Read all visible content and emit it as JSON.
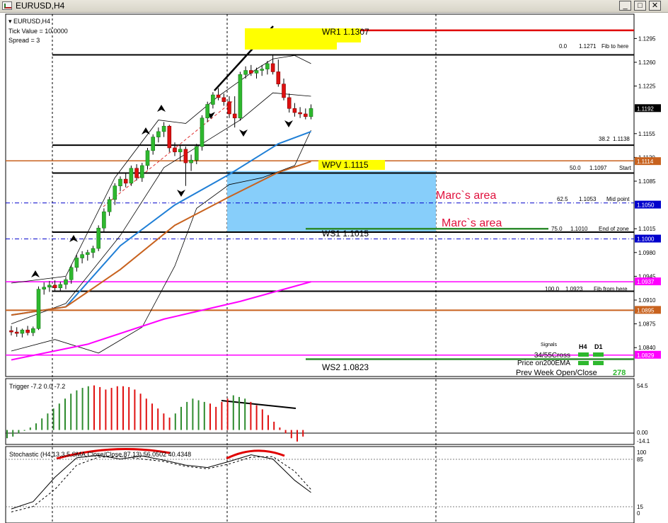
{
  "window": {
    "title": "EURUSD,H4",
    "buttons": [
      "_",
      "□",
      "✕"
    ]
  },
  "chart_data": {
    "type": "candlestick",
    "symbol": "EURUSD",
    "timeframe": "H4",
    "info_lines": [
      "▾ EURUSD,H4",
      "Tick Value = 10.0000",
      "Spread = 3"
    ],
    "ylim": [
      1.081,
      1.131
    ],
    "price_ticks": [
      "1.1295",
      "1.1260",
      "1.1225",
      "1.1155",
      "1.1120",
      "1.1085",
      "1.1015",
      "1.0980",
      "1.0945",
      "1.0910",
      "1.0875",
      "1.0840"
    ],
    "price_badges": [
      {
        "label": "1.1192",
        "value": 1.1192,
        "color": "#000000"
      },
      {
        "label": "1.1114",
        "value": 1.1114,
        "color": "#c8621e"
      },
      {
        "label": "1.1050",
        "value": 1.105,
        "color": "#0000cc"
      },
      {
        "label": "1.1000",
        "value": 1.1,
        "color": "#0000cc"
      },
      {
        "label": "1.0937",
        "value": 1.0937,
        "color": "#ff00ff"
      },
      {
        "label": "1.0895",
        "value": 1.0895,
        "color": "#c8621e"
      },
      {
        "label": "1.0829",
        "value": 1.0829,
        "color": "#ff00ff"
      }
    ],
    "candles": [
      [
        1.0865,
        1.0872,
        1.0858,
        1.0863
      ],
      [
        1.0863,
        1.087,
        1.0856,
        1.0861
      ],
      [
        1.0861,
        1.0868,
        1.0855,
        1.0866
      ],
      [
        1.0866,
        1.0872,
        1.0858,
        1.0862
      ],
      [
        1.0862,
        1.0871,
        1.0857,
        1.0868
      ],
      [
        1.0868,
        1.093,
        1.0866,
        1.0926
      ],
      [
        1.0926,
        1.0936,
        1.0918,
        1.0929
      ],
      [
        1.0929,
        1.0938,
        1.0922,
        1.0932
      ],
      [
        1.0932,
        1.0939,
        1.0924,
        1.0928
      ],
      [
        1.0928,
        1.0937,
        1.0922,
        1.0933
      ],
      [
        1.0933,
        1.0944,
        1.0926,
        1.094
      ],
      [
        1.094,
        1.0962,
        1.0934,
        1.0958
      ],
      [
        1.0958,
        1.0976,
        1.0952,
        1.0972
      ],
      [
        1.0972,
        1.0982,
        1.0964,
        1.0977
      ],
      [
        1.0977,
        1.0984,
        1.0968,
        1.098
      ],
      [
        1.098,
        1.099,
        1.0972,
        1.0986
      ],
      [
        1.0986,
        1.102,
        1.0982,
        1.1016
      ],
      [
        1.1016,
        1.1045,
        1.101,
        1.104
      ],
      [
        1.104,
        1.1062,
        1.1034,
        1.1058
      ],
      [
        1.1058,
        1.1082,
        1.105,
        1.1078
      ],
      [
        1.1078,
        1.1092,
        1.107,
        1.1088
      ],
      [
        1.1088,
        1.1096,
        1.1076,
        1.1082
      ],
      [
        1.1082,
        1.1108,
        1.1078,
        1.1104
      ],
      [
        1.1104,
        1.111,
        1.1086,
        1.109
      ],
      [
        1.109,
        1.1112,
        1.1084,
        1.1108
      ],
      [
        1.1108,
        1.1134,
        1.1102,
        1.113
      ],
      [
        1.113,
        1.1154,
        1.1124,
        1.115
      ],
      [
        1.115,
        1.1164,
        1.1142,
        1.1158
      ],
      [
        1.1158,
        1.1172,
        1.115,
        1.1166
      ],
      [
        1.1166,
        1.1168,
        1.1128,
        1.1134
      ],
      [
        1.1134,
        1.1142,
        1.1122,
        1.1128
      ],
      [
        1.1128,
        1.1138,
        1.1114,
        1.1132
      ],
      [
        1.1132,
        1.1136,
        1.1078,
        1.1112
      ],
      [
        1.1112,
        1.1124,
        1.11,
        1.1116
      ],
      [
        1.1116,
        1.114,
        1.111,
        1.1136
      ],
      [
        1.1136,
        1.1182,
        1.113,
        1.1178
      ],
      [
        1.1178,
        1.1202,
        1.1172,
        1.1198
      ],
      [
        1.1198,
        1.1216,
        1.1192,
        1.1212
      ],
      [
        1.1212,
        1.1222,
        1.1204,
        1.1208
      ],
      [
        1.1208,
        1.1214,
        1.1196,
        1.1202
      ],
      [
        1.1202,
        1.121,
        1.1178,
        1.1184
      ],
      [
        1.1184,
        1.121,
        1.1164,
        1.1178
      ],
      [
        1.1178,
        1.1246,
        1.1174,
        1.1242
      ],
      [
        1.1242,
        1.1254,
        1.1236,
        1.1248
      ],
      [
        1.1248,
        1.1256,
        1.124,
        1.1244
      ],
      [
        1.1244,
        1.1252,
        1.1236,
        1.1248
      ],
      [
        1.1248,
        1.1256,
        1.124,
        1.125
      ],
      [
        1.125,
        1.1262,
        1.1242,
        1.1258
      ],
      [
        1.1258,
        1.127,
        1.1242,
        1.1246
      ],
      [
        1.1246,
        1.1264,
        1.1224,
        1.1228
      ],
      [
        1.1228,
        1.1236,
        1.1204,
        1.1208
      ],
      [
        1.1208,
        1.1214,
        1.1186,
        1.1192
      ],
      [
        1.1192,
        1.12,
        1.118,
        1.1186
      ],
      [
        1.1186,
        1.1194,
        1.1178,
        1.1184
      ],
      [
        1.1184,
        1.1192,
        1.1176,
        1.118
      ],
      [
        1.118,
        1.1198,
        1.1176,
        1.1192
      ]
    ],
    "moving_averages": [
      {
        "name": "ma-blue",
        "color": "#1f7fd6",
        "values": [
          [
            0,
            1.0888
          ],
          [
            10,
            1.09
          ],
          [
            20,
            1.099
          ],
          [
            30,
            1.105
          ],
          [
            40,
            1.1095
          ],
          [
            49,
            1.114
          ],
          [
            55,
            1.1158
          ]
        ]
      },
      {
        "name": "ma-orange",
        "color": "#c8621e",
        "values": [
          [
            0,
            1.0888
          ],
          [
            10,
            1.09
          ],
          [
            20,
            1.0955
          ],
          [
            30,
            1.102
          ],
          [
            40,
            1.1062
          ],
          [
            49,
            1.1098
          ],
          [
            55,
            1.1114
          ]
        ]
      },
      {
        "name": "ma-200ema-magenta",
        "color": "#ff00ff",
        "values": [
          [
            0,
            1.0822
          ],
          [
            14,
            1.0845
          ],
          [
            28,
            1.0882
          ],
          [
            42,
            1.0908
          ],
          [
            55,
            1.0937
          ]
        ]
      }
    ],
    "bollinger": {
      "upper": [
        [
          0,
          1.0935
        ],
        [
          10,
          1.0945
        ],
        [
          19,
          1.109
        ],
        [
          27,
          1.1175
        ],
        [
          32,
          1.117
        ],
        [
          38,
          1.121
        ],
        [
          45,
          1.125
        ],
        [
          48,
          1.1265
        ],
        [
          52,
          1.127
        ],
        [
          55,
          1.1258
        ]
      ],
      "middle": [
        [
          0,
          1.0875
        ],
        [
          10,
          1.0905
        ],
        [
          20,
          1.1005
        ],
        [
          28,
          1.1105
        ],
        [
          35,
          1.114
        ],
        [
          42,
          1.1175
        ],
        [
          48,
          1.1215
        ],
        [
          55,
          1.121
        ]
      ],
      "lower": [
        [
          0,
          1.0835
        ],
        [
          8,
          1.0852
        ],
        [
          16,
          1.0832
        ],
        [
          24,
          1.087
        ],
        [
          30,
          1.096
        ],
        [
          34,
          1.1045
        ],
        [
          40,
          1.108
        ],
        [
          46,
          1.109
        ],
        [
          52,
          1.1108
        ],
        [
          55,
          1.116
        ]
      ]
    },
    "zone": {
      "from_value": 1.101,
      "to_value": 1.11,
      "color": "#87cefa"
    },
    "levels": [
      {
        "name": "wr1",
        "label": "WR1  1.1307",
        "value": 1.1307,
        "color": "#e00000",
        "width": 2.5
      },
      {
        "name": "fib-0",
        "value": 1.1271,
        "color": "#000000",
        "width": 2
      },
      {
        "name": "fib-38",
        "value": 1.1138,
        "color": "#000000",
        "width": 2
      },
      {
        "name": "wpv",
        "label": "WPV  1.1115",
        "value": 1.1115,
        "color": "#c8621e",
        "width": 1.5
      },
      {
        "name": "fib-50",
        "value": 1.1097,
        "color": "#000000",
        "width": 2
      },
      {
        "name": "fib-62",
        "value": 1.1053,
        "color": "#0000cc",
        "width": 1,
        "dash": true
      },
      {
        "name": "ws1",
        "label": "WS1  1.1015",
        "value": 1.1015,
        "color": "#2e8b2e",
        "width": 2.5
      },
      {
        "name": "fib-75",
        "value": 1.101,
        "color": "#000000",
        "width": 2
      },
      {
        "name": "pivot-1000",
        "value": 1.1,
        "color": "#0000cc",
        "width": 1,
        "dash": true
      },
      {
        "name": "magenta-0937",
        "value": 1.0937,
        "color": "#ff00ff",
        "width": 1.5
      },
      {
        "name": "fib-100",
        "value": 1.0923,
        "color": "#000000",
        "width": 2
      },
      {
        "name": "orange-0895",
        "value": 1.0895,
        "color": "#c8621e",
        "width": 2
      },
      {
        "name": "magenta-0829",
        "value": 1.0829,
        "color": "#ff00ff",
        "width": 1.5
      },
      {
        "name": "ws2",
        "label": "WS2  1.0823",
        "value": 1.0823,
        "color": "#2e8b2e",
        "width": 2.5
      }
    ],
    "fib_labels": [
      {
        "name": "fib-0-label",
        "level": "0.0",
        "price": "1.1271",
        "tag": "Fib to here"
      },
      {
        "name": "fib-38-label",
        "level": "38.2",
        "price": "1.1138",
        "tag": ""
      },
      {
        "name": "fib-50-label",
        "level": "50.0",
        "price": "1.1097",
        "tag": "Start"
      },
      {
        "name": "fib-62-label",
        "level": "62.5",
        "price": "1.1053",
        "tag": "Mid point"
      },
      {
        "name": "fib-75-label",
        "level": "75.0",
        "price": "1.1010",
        "tag": "End of zone"
      },
      {
        "name": "fib-100-label",
        "level": "100.0",
        "price": "1.0923",
        "tag": "Fib from here"
      }
    ],
    "annotations": [
      {
        "name": "marcs-area-1",
        "text": "Marc`s area",
        "color": "#e0103c"
      },
      {
        "name": "marcs-area-2",
        "text": "Marc`s area",
        "color": "#e0103c"
      }
    ],
    "signals_panel": {
      "title": "Signals",
      "headers": [
        "H4",
        "D1"
      ],
      "rows": [
        "34/55Cross",
        "Price on200EMA"
      ],
      "footer_label": "Prev Week Open/Close",
      "footer_value": "278",
      "signal_color": "#2eb82e"
    },
    "trigger": {
      "label": "Trigger -7.2 0.0 -7.2",
      "scale": [
        "54.5",
        "0.00",
        "-14.1"
      ],
      "ylim": [
        -14.1,
        54.5
      ],
      "values": [
        -10,
        -8,
        -4,
        -1,
        3,
        8,
        14,
        20,
        26,
        32,
        38,
        44,
        48,
        51,
        53,
        54,
        52,
        49,
        51,
        53,
        53,
        52,
        49,
        44,
        38,
        32,
        26,
        20,
        15,
        20,
        28,
        34,
        38,
        36,
        34,
        32,
        28,
        34,
        38,
        42,
        40,
        38,
        34,
        30,
        25,
        18,
        10,
        3,
        -4,
        -10,
        -14,
        -8
      ],
      "colors": "gggggggggggggggrrrrrrrrrrrrrrggggggrrrrgggrrrrrrrrrr"
    },
    "stochastic": {
      "label": "Stochastic (H4,13,3,5,SMA,Close/Close,87.13) 56.0502 40.4348",
      "scale": [
        "100",
        "85",
        "15",
        "0"
      ],
      "k": [
        [
          0,
          8
        ],
        [
          4,
          20
        ],
        [
          8,
          60
        ],
        [
          12,
          92
        ],
        [
          16,
          96
        ],
        [
          20,
          90
        ],
        [
          24,
          95
        ],
        [
          28,
          88
        ],
        [
          32,
          80
        ],
        [
          36,
          76
        ],
        [
          40,
          86
        ],
        [
          44,
          97
        ],
        [
          48,
          90
        ],
        [
          52,
          55
        ],
        [
          55,
          35
        ]
      ],
      "d": [
        [
          0,
          3
        ],
        [
          4,
          12
        ],
        [
          8,
          40
        ],
        [
          12,
          80
        ],
        [
          16,
          93
        ],
        [
          20,
          94
        ],
        [
          24,
          90
        ],
        [
          28,
          86
        ],
        [
          32,
          78
        ],
        [
          36,
          74
        ],
        [
          40,
          82
        ],
        [
          44,
          93
        ],
        [
          48,
          94
        ],
        [
          52,
          70
        ],
        [
          55,
          40
        ]
      ]
    }
  }
}
